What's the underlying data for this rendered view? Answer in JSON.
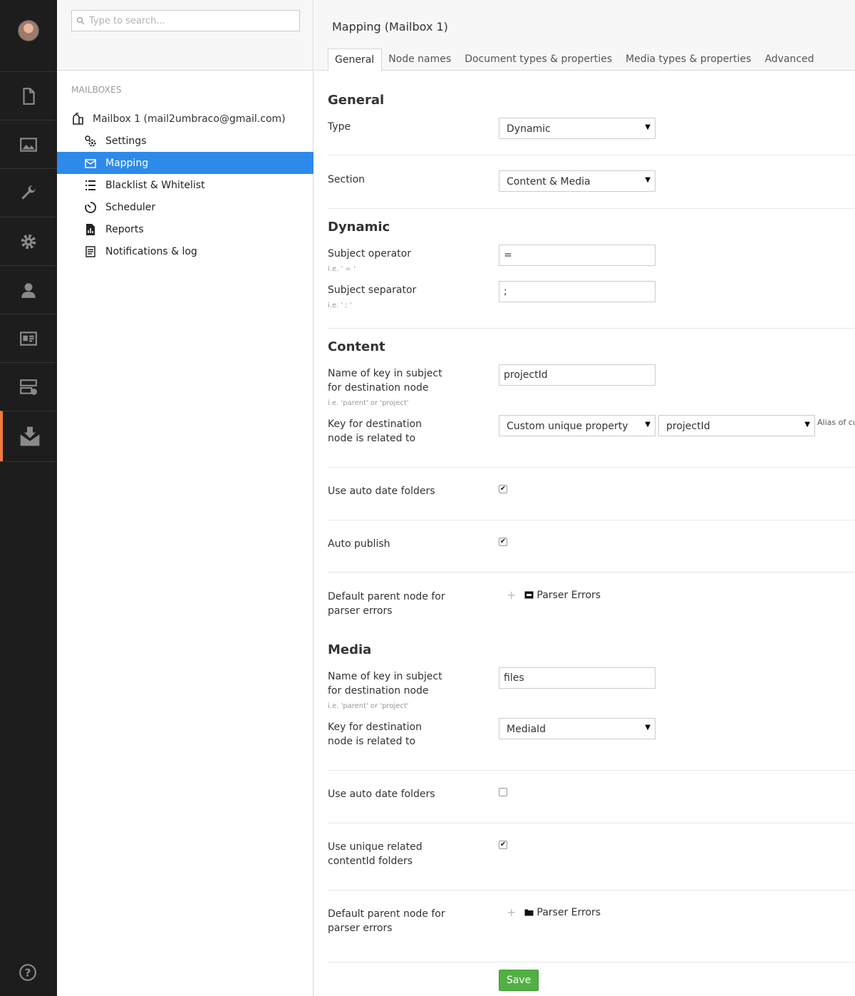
{
  "search": {
    "placeholder": "Type to search..."
  },
  "tree": {
    "heading": "MAILBOXES",
    "root": "Mailbox 1 (mail2umbraco@gmail.com)",
    "items": [
      {
        "label": "Settings"
      },
      {
        "label": "Mapping"
      },
      {
        "label": "Blacklist & Whitelist"
      },
      {
        "label": "Scheduler"
      },
      {
        "label": "Reports"
      },
      {
        "label": "Notifications & log"
      }
    ]
  },
  "main": {
    "title": "Mapping (Mailbox 1)",
    "tabs": [
      {
        "label": "General"
      },
      {
        "label": "Node names"
      },
      {
        "label": "Document types & properties"
      },
      {
        "label": "Media types & properties"
      },
      {
        "label": "Advanced"
      }
    ]
  },
  "general": {
    "heading": "General",
    "type_label": "Type",
    "type_value": "Dynamic",
    "section_label": "Section",
    "section_value": "Content & Media"
  },
  "dynamic": {
    "heading": "Dynamic",
    "operator_label": "Subject operator",
    "operator_hint": "i.e. ' = '",
    "operator_value": "=",
    "separator_label": "Subject separator",
    "separator_hint": "i.e. ' ; '",
    "separator_value": ";"
  },
  "content": {
    "heading": "Content",
    "key_label_1": "Name of key in subject",
    "key_label_2": "for destination node",
    "key_hint": "i.e. 'parent' or 'project'",
    "key_value": "projectId",
    "related_label_1": "Key for destination",
    "related_label_2": "node is related to",
    "related_value": "Custom unique property",
    "related_alias_value": "projectId",
    "alias_note": "Alias of custom property",
    "auto_date_label": "Use auto date folders",
    "auto_date_checked": true,
    "auto_publish_label": "Auto publish",
    "auto_publish_checked": true,
    "parent_label_1": "Default parent node for",
    "parent_label_2": "parser errors",
    "parent_node": "Parser Errors"
  },
  "media": {
    "heading": "Media",
    "key_label_1": "Name of key in subject",
    "key_label_2": "for destination node",
    "key_hint": "i.e. 'parent' or 'project'",
    "key_value": "files",
    "related_label_1": "Key for destination",
    "related_label_2": "node is related to",
    "related_value": "MediaId",
    "auto_date_label": "Use auto date folders",
    "auto_date_checked": false,
    "unique_label_1": "Use unique related",
    "unique_label_2": "contentId folders",
    "unique_checked": true,
    "parent_label_1": "Default parent node for",
    "parent_label_2": "parser errors",
    "parent_node": "Parser Errors"
  },
  "buttons": {
    "save": "Save"
  },
  "colors": {
    "accent": "#2e8aea",
    "active_section": "#f27c3a",
    "save": "#52b043",
    "sidebar": "#1d1d1d"
  }
}
